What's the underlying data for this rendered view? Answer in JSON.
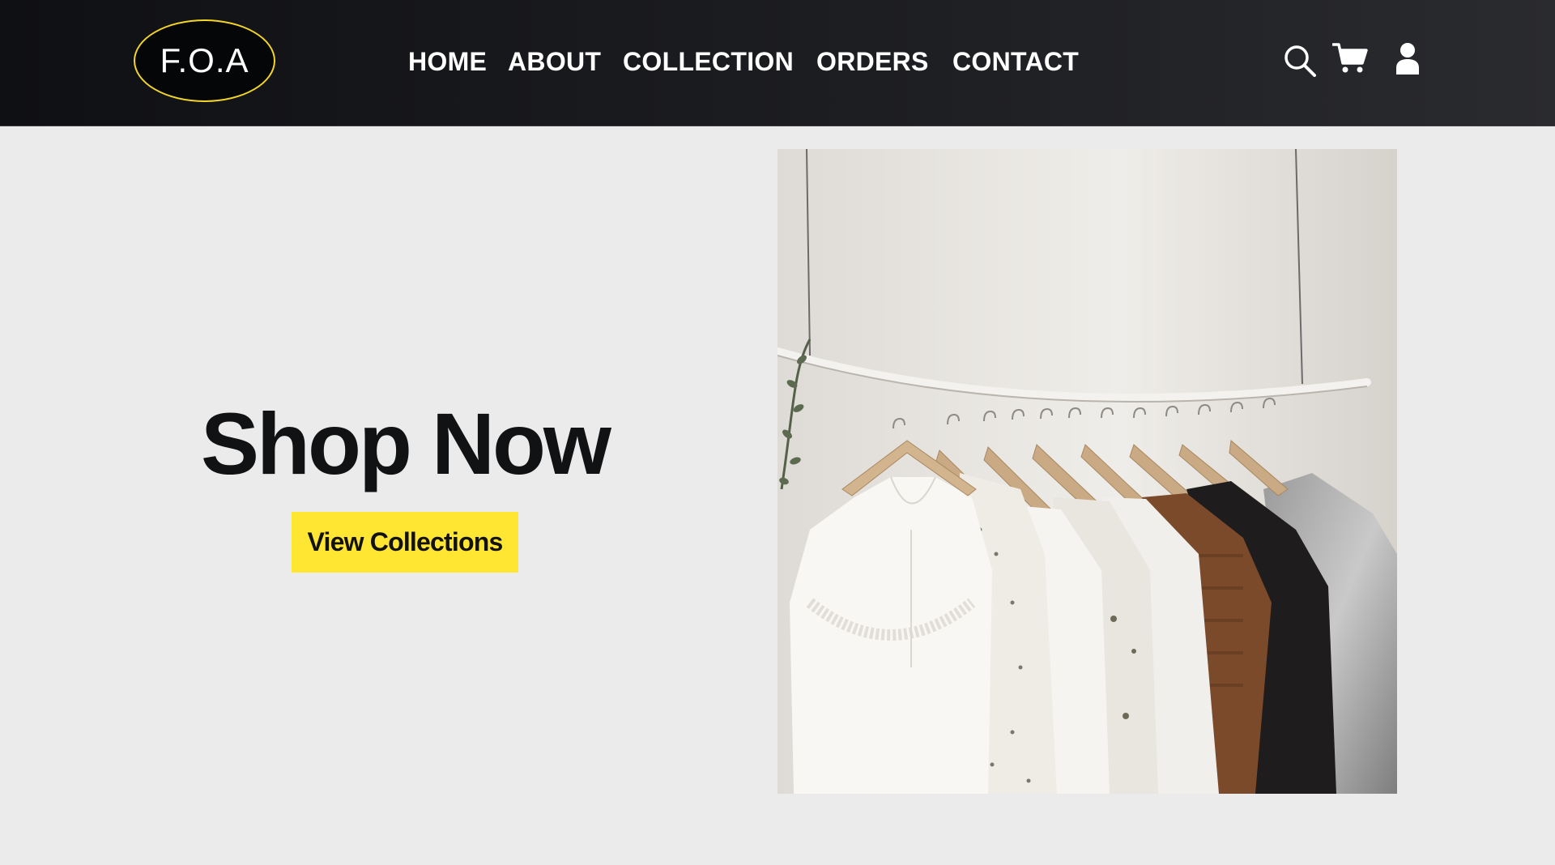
{
  "brand": {
    "logo_text": "F.O.A",
    "accent": "#f2d528"
  },
  "nav": {
    "items": [
      {
        "label": "HOME"
      },
      {
        "label": "ABOUT"
      },
      {
        "label": "COLLECTION"
      },
      {
        "label": "ORDERS"
      },
      {
        "label": "CONTACT"
      }
    ]
  },
  "header_icons": [
    "search-icon",
    "cart-icon",
    "user-icon"
  ],
  "hero": {
    "title": "Shop Now",
    "cta_label": "View Collections",
    "cta_color": "#ffe632",
    "image_subject": "clothes-rack-photo"
  }
}
